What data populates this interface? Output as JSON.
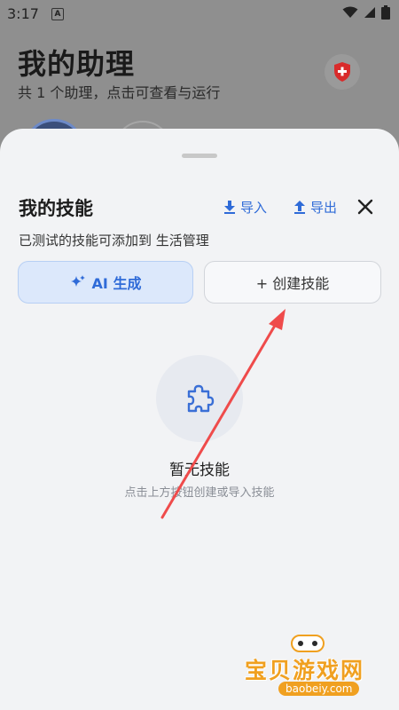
{
  "status_bar": {
    "time": "3:17",
    "indicator": "A"
  },
  "background_page": {
    "title": "我的助理",
    "subtitle": "共 1 个助理，点击可查看与运行"
  },
  "sheet": {
    "title": "我的技能",
    "import_label": "导入",
    "export_label": "导出",
    "description": "已测试的技能可添加到 生活管理",
    "ai_generate_label": "AI 生成",
    "create_skill_label": "+ 创建技能",
    "empty_title": "暂无技能",
    "empty_hint": "点击上方按钮创建或导入技能"
  },
  "watermark": {
    "text": "宝贝游戏网",
    "url": "baobeiy.com"
  },
  "colors": {
    "accent": "#2f6bd8",
    "annotation_arrow": "#ef4b4b",
    "watermark": "#f0a020",
    "shield": "#d92b2b"
  }
}
